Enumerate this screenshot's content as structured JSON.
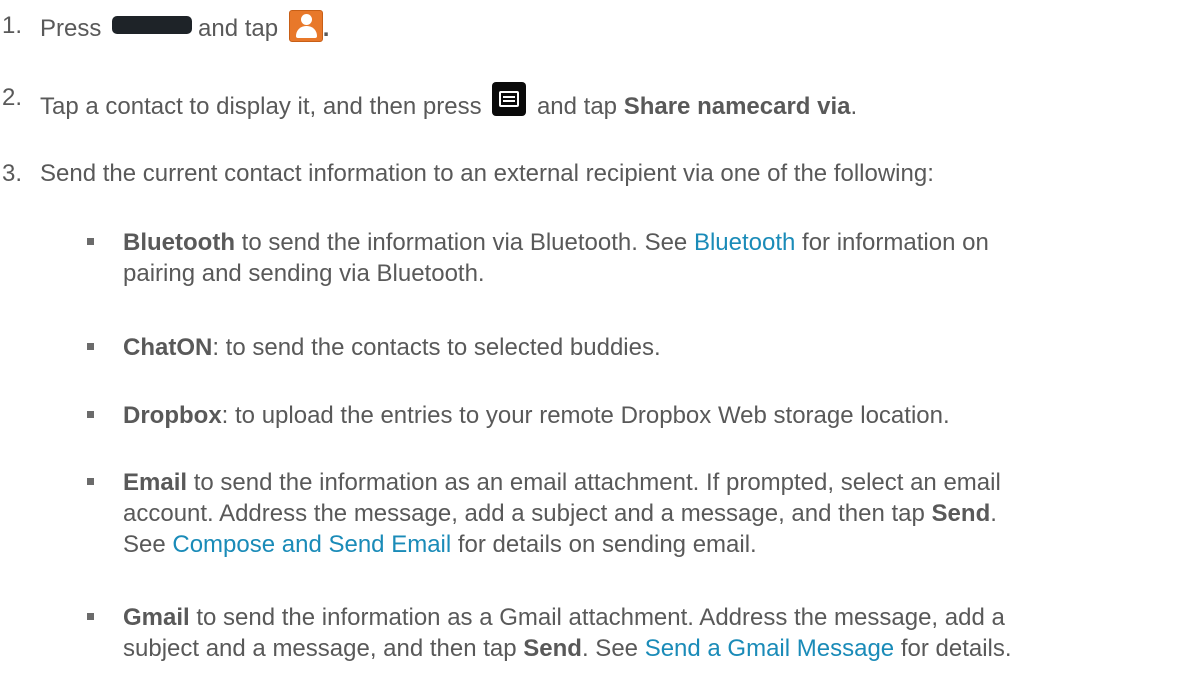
{
  "steps": [
    {
      "number": "1.",
      "press": "Press",
      "and_tap": "and tap",
      "end": "."
    },
    {
      "number": "2.",
      "text_before": "Tap a contact to display it, and then press",
      "and_tap": "and tap",
      "bold": "Share namecard via",
      "end": "."
    },
    {
      "number": "3.",
      "text": "Send the current contact information to an external recipient via one of the following:"
    }
  ],
  "options": [
    {
      "bold": "Bluetooth",
      "line1_pre": " to send the information via Bluetooth. See ",
      "link": "Bluetooth",
      "line1_post": " for information on",
      "line2": "pairing and sending via Bluetooth."
    },
    {
      "bold": "ChatON",
      "text": ": to send the contacts to selected buddies."
    },
    {
      "bold": "Dropbox",
      "text": ": to upload the entries to your remote Dropbox Web storage location."
    },
    {
      "bold": "Email",
      "line1": " to send the information as an email attachment. If prompted, select an email",
      "line2_pre": "account. Address the message, add a subject and a message, and then tap ",
      "bold2": "Send",
      "line2_end": ".",
      "line3_pre": "See ",
      "link": "Compose and Send Email",
      "line3_post": " for details on sending email."
    },
    {
      "bold": "Gmail",
      "line1": " to send the information as a Gmail attachment. Address the message, add a",
      "line2_pre": "subject and a message, and then tap ",
      "bold2": "Send",
      "line2_mid": ". See ",
      "link": "Send a Gmail Message",
      "line2_post": " for details."
    }
  ],
  "icons": {
    "home_key": "home-key-icon",
    "contacts_app": "contacts-app-icon",
    "menu_key": "menu-key-icon"
  },
  "colors": {
    "text": "#595959",
    "link": "#1a8bb8",
    "contacts_icon": "#e8782a"
  }
}
